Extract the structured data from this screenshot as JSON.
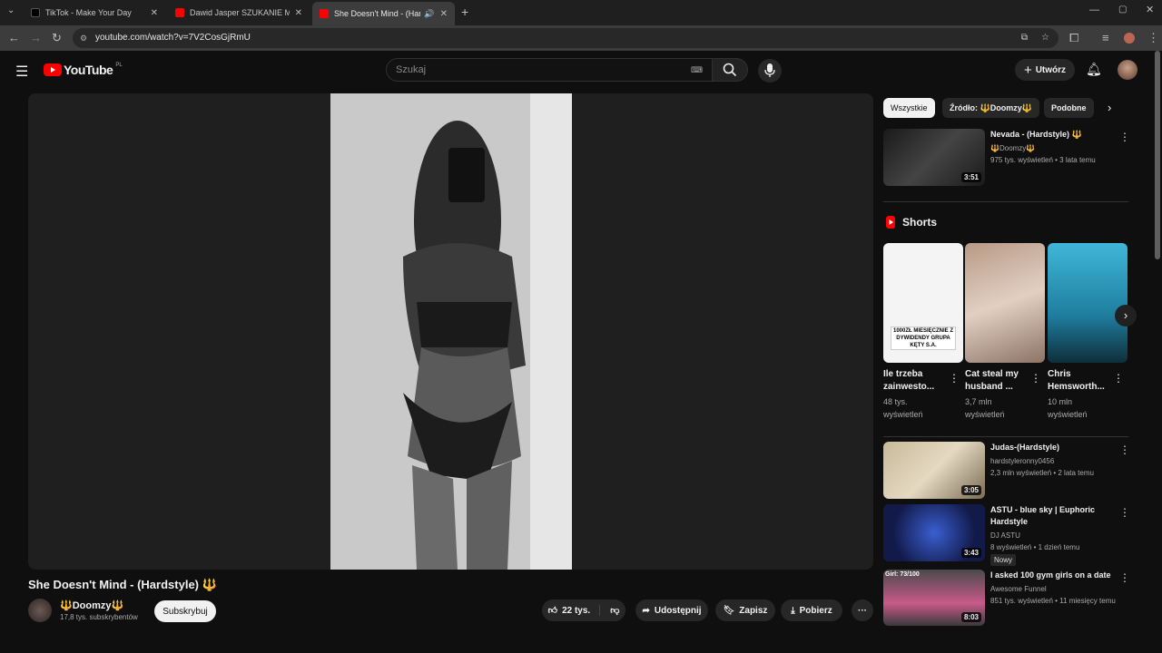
{
  "browser": {
    "tabs": [
      {
        "title": "TikTok - Make Your Day"
      },
      {
        "title": "Dawid Jasper SZUKANIE MIŁOŚ"
      },
      {
        "title": "She Doesn't Mind - (Hards"
      }
    ],
    "url": "youtube.com/watch?v=7V2CosGjRmU"
  },
  "header": {
    "logo": "YouTube",
    "region": "PL",
    "search_placeholder": "Szukaj",
    "create_label": "Utwórz"
  },
  "video": {
    "title": "She Doesn't Mind - (Hardstyle) 🔱",
    "channel": "🔱Doomzy🔱",
    "subscribers": "17,8 tys. subskrybentów",
    "subscribe_label": "Subskrybuj",
    "likes": "22 tys.",
    "share_label": "Udostępnij",
    "save_label": "Zapisz",
    "download_label": "Pobierz"
  },
  "chips": [
    "Wszystkie",
    "Źródło: 🔱Doomzy🔱",
    "Podobne"
  ],
  "related_top": {
    "title": "Nevada - (Hardstyle) 🔱",
    "channel": "🔱Doomzy🔱",
    "meta": "975 tys. wyświetleń • 3 lata temu",
    "duration": "3:51"
  },
  "shorts": {
    "heading": "Shorts",
    "items": [
      {
        "title": "Ile trzeba zainwesto...",
        "views": "48 tys. wyświetleń",
        "overlay": "1000ZŁ MIESIĘCZNIE Z DYWIDENDY GRUPA KĘTY S.A."
      },
      {
        "title": "Cat steal my husband ...",
        "views": "3,7 mln wyświetleń"
      },
      {
        "title": "Chris Hemsworth...",
        "views": "10 mln wyświetleń"
      }
    ]
  },
  "related": [
    {
      "title": "Judas-(Hardstyle)",
      "channel": "hardstyleronny0456",
      "meta": "2,3 mln wyświetleń • 2 lata temu",
      "duration": "3:05"
    },
    {
      "title": "ASTU - blue sky | Euphoric Hardstyle",
      "channel": "DJ ASTU",
      "meta": "8 wyświetleń • 1 dzień temu",
      "badge": "Nowy",
      "duration": "3:43"
    },
    {
      "title": "I asked 100 gym girls on a date",
      "channel": "Awesome Funnel",
      "meta": "851 tys. wyświetleń • 11 miesięcy temu",
      "duration": "8:03",
      "overlay": "Girl: 73/100"
    }
  ]
}
